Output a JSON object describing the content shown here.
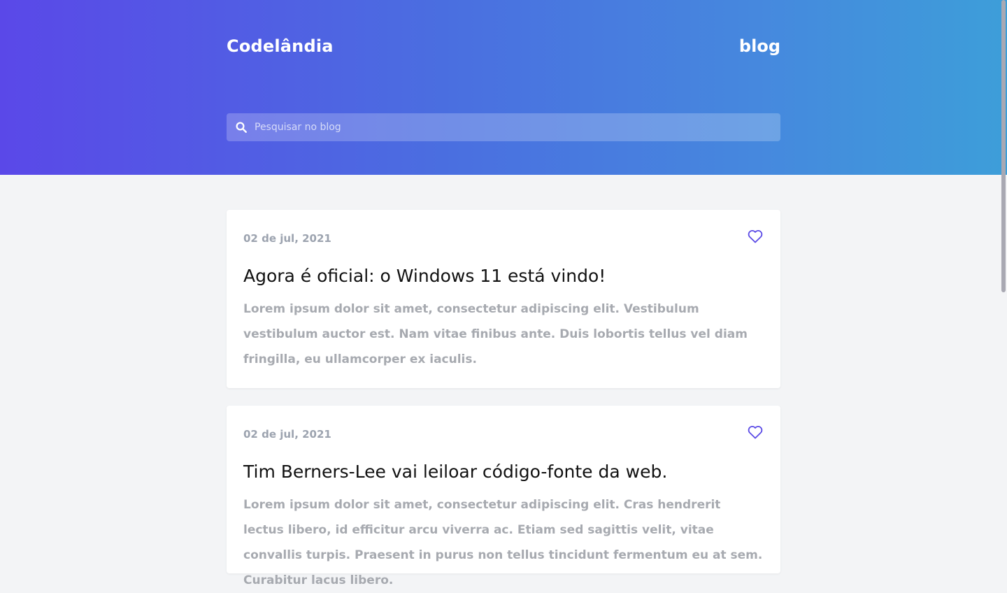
{
  "header": {
    "brand": "Codelândia",
    "nav_blog": "blog",
    "search_placeholder": "Pesquisar no blog",
    "search_value": ""
  },
  "posts": [
    {
      "date": "02 de jul, 2021",
      "title": "Agora é oficial: o Windows 11 está vindo!",
      "body": "Lorem ipsum dolor sit amet, consectetur adipiscing elit. Vestibulum vestibulum auctor est. Nam vitae finibus ante. Duis lobortis tellus vel diam fringilla, eu ullamcorper ex iaculis."
    },
    {
      "date": "02 de jul, 2021",
      "title": "Tim Berners-Lee vai leiloar código-fonte da web.",
      "body": "Lorem ipsum dolor sit amet, consectetur adipiscing elit. Cras hendrerit lectus libero, id efficitur arcu viverra ac. Etiam sed sagittis velit, vitae convallis turpis. Praesent in purus non tellus tincidunt fermentum eu at sem. Curabitur lacus libero."
    }
  ],
  "icons": {
    "search": "search-icon",
    "favorite": "heart-icon"
  },
  "colors": {
    "gradient_start": "#5a48e8",
    "gradient_end": "#3d9ed9",
    "accent": "#5b4be6",
    "muted_text": "#a7aab0",
    "page_bg": "#f3f4f6"
  }
}
